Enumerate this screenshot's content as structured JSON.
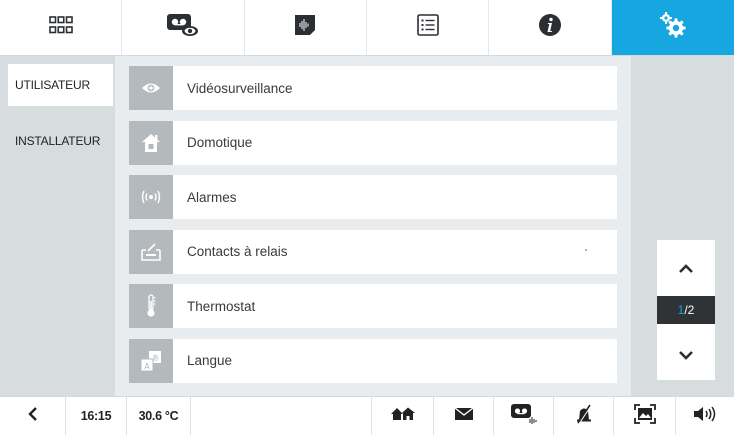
{
  "top_nav": {
    "tabs": [
      {
        "icon": "apps-grid-icon"
      },
      {
        "icon": "video-message-icon"
      },
      {
        "icon": "voice-memo-icon"
      },
      {
        "icon": "list-icon"
      },
      {
        "icon": "info-icon"
      },
      {
        "icon": "settings-gears-icon",
        "active": true
      }
    ],
    "accent_color": "#16a7e0"
  },
  "sidebar": {
    "items": [
      {
        "label": "UTILISATEUR",
        "selected": true
      },
      {
        "label": "INSTALLATEUR",
        "selected": false
      }
    ]
  },
  "settings_list": {
    "items": [
      {
        "label": "Vidéosurveillance",
        "icon": "eye-icon"
      },
      {
        "label": "Domotique",
        "icon": "home-automation-icon"
      },
      {
        "label": "Alarmes",
        "icon": "alarm-signal-icon"
      },
      {
        "label": "Contacts à relais",
        "icon": "relay-contact-icon"
      },
      {
        "label": "Thermostat",
        "icon": "thermometer-icon"
      },
      {
        "label": "Langue",
        "icon": "language-icon"
      }
    ],
    "icon_bg_color": "#b4b9bd"
  },
  "pager": {
    "current": "1",
    "separator": "/",
    "total": "2"
  },
  "status_bar": {
    "time": "16:15",
    "temperature": "30.6 °C",
    "icons": [
      "back-arrow-icon",
      "presence-home-icon",
      "message-envelope-icon",
      "video-memo-icon",
      "ringer-off-icon",
      "screen-fullscreen-icon",
      "volume-icon"
    ]
  }
}
